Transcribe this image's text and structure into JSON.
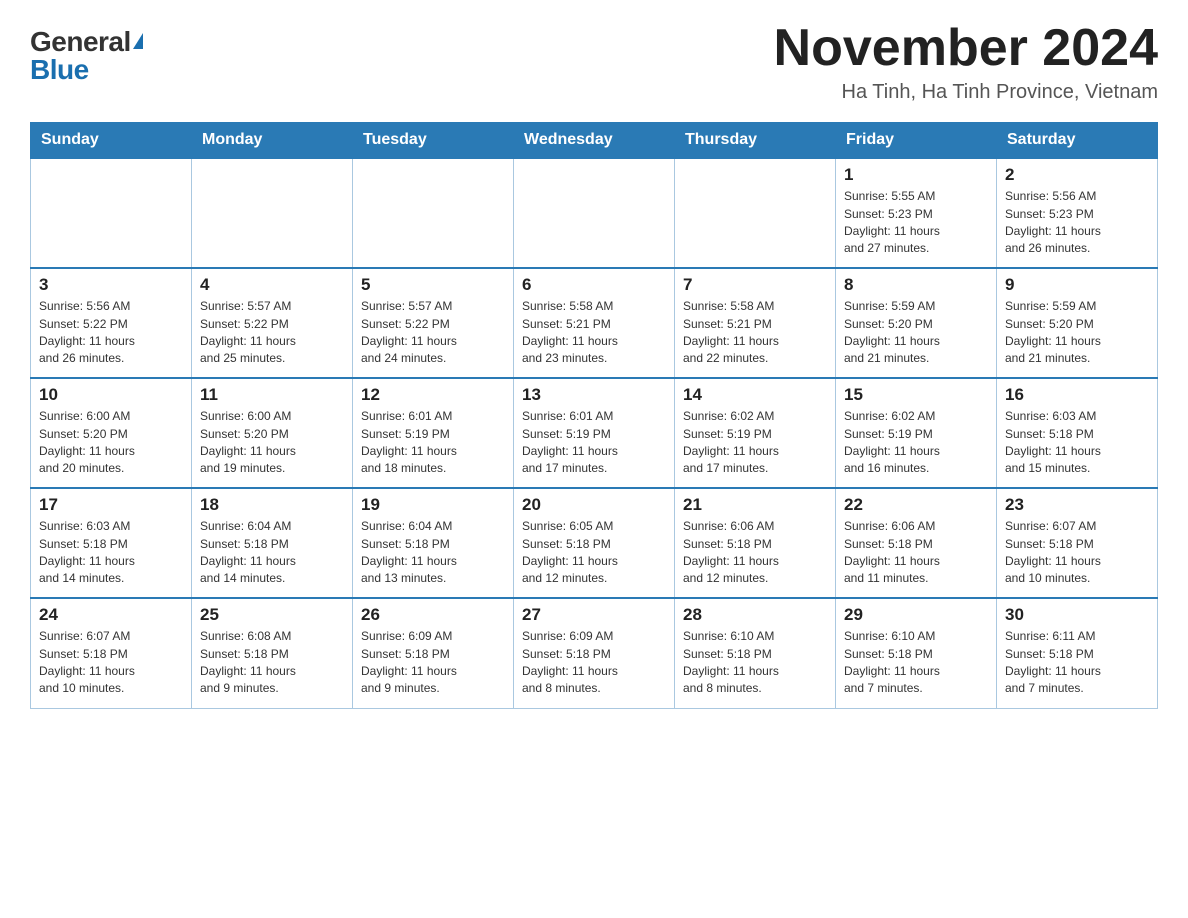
{
  "header": {
    "logo_general": "General",
    "logo_blue": "Blue",
    "month_title": "November 2024",
    "location": "Ha Tinh, Ha Tinh Province, Vietnam"
  },
  "days_of_week": [
    "Sunday",
    "Monday",
    "Tuesday",
    "Wednesday",
    "Thursday",
    "Friday",
    "Saturday"
  ],
  "weeks": [
    [
      {
        "day": "",
        "info": ""
      },
      {
        "day": "",
        "info": ""
      },
      {
        "day": "",
        "info": ""
      },
      {
        "day": "",
        "info": ""
      },
      {
        "day": "",
        "info": ""
      },
      {
        "day": "1",
        "info": "Sunrise: 5:55 AM\nSunset: 5:23 PM\nDaylight: 11 hours\nand 27 minutes."
      },
      {
        "day": "2",
        "info": "Sunrise: 5:56 AM\nSunset: 5:23 PM\nDaylight: 11 hours\nand 26 minutes."
      }
    ],
    [
      {
        "day": "3",
        "info": "Sunrise: 5:56 AM\nSunset: 5:22 PM\nDaylight: 11 hours\nand 26 minutes."
      },
      {
        "day": "4",
        "info": "Sunrise: 5:57 AM\nSunset: 5:22 PM\nDaylight: 11 hours\nand 25 minutes."
      },
      {
        "day": "5",
        "info": "Sunrise: 5:57 AM\nSunset: 5:22 PM\nDaylight: 11 hours\nand 24 minutes."
      },
      {
        "day": "6",
        "info": "Sunrise: 5:58 AM\nSunset: 5:21 PM\nDaylight: 11 hours\nand 23 minutes."
      },
      {
        "day": "7",
        "info": "Sunrise: 5:58 AM\nSunset: 5:21 PM\nDaylight: 11 hours\nand 22 minutes."
      },
      {
        "day": "8",
        "info": "Sunrise: 5:59 AM\nSunset: 5:20 PM\nDaylight: 11 hours\nand 21 minutes."
      },
      {
        "day": "9",
        "info": "Sunrise: 5:59 AM\nSunset: 5:20 PM\nDaylight: 11 hours\nand 21 minutes."
      }
    ],
    [
      {
        "day": "10",
        "info": "Sunrise: 6:00 AM\nSunset: 5:20 PM\nDaylight: 11 hours\nand 20 minutes."
      },
      {
        "day": "11",
        "info": "Sunrise: 6:00 AM\nSunset: 5:20 PM\nDaylight: 11 hours\nand 19 minutes."
      },
      {
        "day": "12",
        "info": "Sunrise: 6:01 AM\nSunset: 5:19 PM\nDaylight: 11 hours\nand 18 minutes."
      },
      {
        "day": "13",
        "info": "Sunrise: 6:01 AM\nSunset: 5:19 PM\nDaylight: 11 hours\nand 17 minutes."
      },
      {
        "day": "14",
        "info": "Sunrise: 6:02 AM\nSunset: 5:19 PM\nDaylight: 11 hours\nand 17 minutes."
      },
      {
        "day": "15",
        "info": "Sunrise: 6:02 AM\nSunset: 5:19 PM\nDaylight: 11 hours\nand 16 minutes."
      },
      {
        "day": "16",
        "info": "Sunrise: 6:03 AM\nSunset: 5:18 PM\nDaylight: 11 hours\nand 15 minutes."
      }
    ],
    [
      {
        "day": "17",
        "info": "Sunrise: 6:03 AM\nSunset: 5:18 PM\nDaylight: 11 hours\nand 14 minutes."
      },
      {
        "day": "18",
        "info": "Sunrise: 6:04 AM\nSunset: 5:18 PM\nDaylight: 11 hours\nand 14 minutes."
      },
      {
        "day": "19",
        "info": "Sunrise: 6:04 AM\nSunset: 5:18 PM\nDaylight: 11 hours\nand 13 minutes."
      },
      {
        "day": "20",
        "info": "Sunrise: 6:05 AM\nSunset: 5:18 PM\nDaylight: 11 hours\nand 12 minutes."
      },
      {
        "day": "21",
        "info": "Sunrise: 6:06 AM\nSunset: 5:18 PM\nDaylight: 11 hours\nand 12 minutes."
      },
      {
        "day": "22",
        "info": "Sunrise: 6:06 AM\nSunset: 5:18 PM\nDaylight: 11 hours\nand 11 minutes."
      },
      {
        "day": "23",
        "info": "Sunrise: 6:07 AM\nSunset: 5:18 PM\nDaylight: 11 hours\nand 10 minutes."
      }
    ],
    [
      {
        "day": "24",
        "info": "Sunrise: 6:07 AM\nSunset: 5:18 PM\nDaylight: 11 hours\nand 10 minutes."
      },
      {
        "day": "25",
        "info": "Sunrise: 6:08 AM\nSunset: 5:18 PM\nDaylight: 11 hours\nand 9 minutes."
      },
      {
        "day": "26",
        "info": "Sunrise: 6:09 AM\nSunset: 5:18 PM\nDaylight: 11 hours\nand 9 minutes."
      },
      {
        "day": "27",
        "info": "Sunrise: 6:09 AM\nSunset: 5:18 PM\nDaylight: 11 hours\nand 8 minutes."
      },
      {
        "day": "28",
        "info": "Sunrise: 6:10 AM\nSunset: 5:18 PM\nDaylight: 11 hours\nand 8 minutes."
      },
      {
        "day": "29",
        "info": "Sunrise: 6:10 AM\nSunset: 5:18 PM\nDaylight: 11 hours\nand 7 minutes."
      },
      {
        "day": "30",
        "info": "Sunrise: 6:11 AM\nSunset: 5:18 PM\nDaylight: 11 hours\nand 7 minutes."
      }
    ]
  ]
}
